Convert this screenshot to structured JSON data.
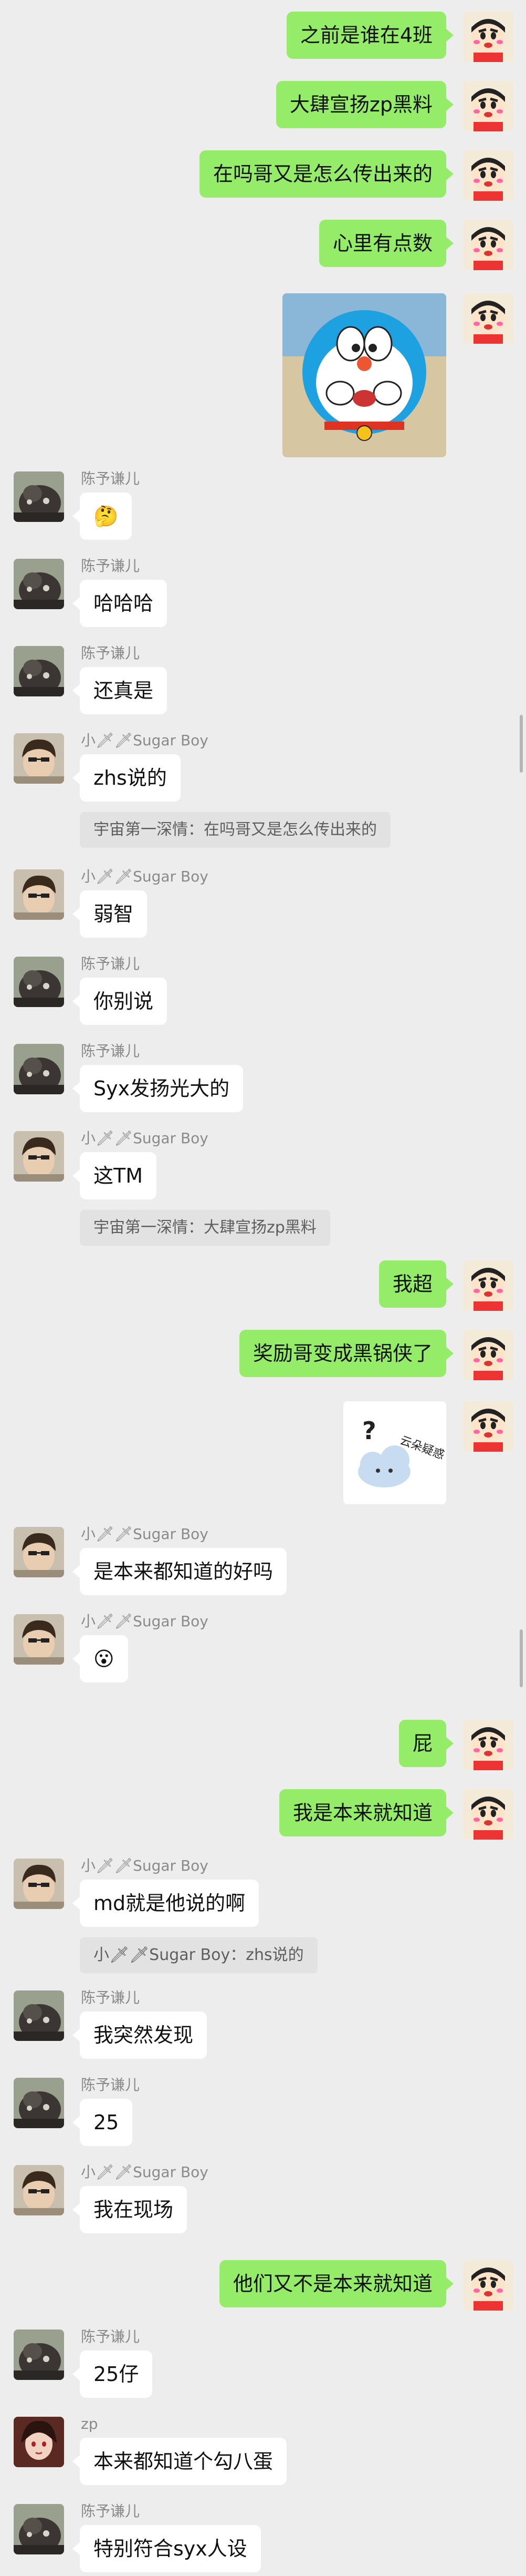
{
  "messages": [
    {
      "side": "self",
      "text": "之前是谁在4班"
    },
    {
      "side": "self",
      "text": "大肆宣扬zp黑料"
    },
    {
      "side": "self",
      "text": "在吗哥又是怎么传出来的"
    },
    {
      "side": "self",
      "text": "心里有点数"
    },
    {
      "side": "self",
      "image": "doraemon-sticker"
    },
    {
      "side": "other",
      "sender": "陈予谦儿",
      "emoji": "🤔"
    },
    {
      "side": "other",
      "sender": "陈予谦儿",
      "text": "哈哈哈"
    },
    {
      "side": "other",
      "sender": "陈予谦儿",
      "text": "还真是"
    },
    {
      "side": "other",
      "sender": "小🗡🗡Sugar Boy",
      "text": "zhs说的",
      "quote": "宇宙第一深情：在吗哥又是怎么传出来的"
    },
    {
      "side": "other",
      "sender": "小🗡🗡Sugar Boy",
      "text": "弱智"
    },
    {
      "side": "other",
      "sender": "陈予谦儿",
      "text": "你别说"
    },
    {
      "side": "other",
      "sender": "陈予谦儿",
      "text": "Syx发扬光大的"
    },
    {
      "side": "other",
      "sender": "小🗡🗡Sugar Boy",
      "text": "这TM",
      "quote": "宇宙第一深情：大肆宣扬zp黑料"
    },
    {
      "side": "self",
      "text": "我超"
    },
    {
      "side": "self",
      "text": "奖励哥变成黑锅侠了"
    },
    {
      "side": "self",
      "image": "cloud-sticker",
      "sticker_text": "云朵疑惑"
    },
    {
      "side": "other",
      "sender": "小🗡🗡Sugar Boy",
      "text": "是本来都知道的好吗"
    },
    {
      "side": "other",
      "sender": "小🗡🗡Sugar Boy",
      "emoji": "😮"
    },
    {
      "side": "self",
      "text": "屁"
    },
    {
      "side": "self",
      "text": "我是本来就知道"
    },
    {
      "side": "other",
      "sender": "小🗡🗡Sugar Boy",
      "text": "md就是他说的啊",
      "quote": "小🗡🗡Sugar Boy：zhs说的"
    },
    {
      "side": "other",
      "sender": "陈予谦儿",
      "text": "我突然发现"
    },
    {
      "side": "other",
      "sender": "陈予谦儿",
      "text": "25"
    },
    {
      "side": "other",
      "sender": "小🗡🗡Sugar Boy",
      "text": "我在现场"
    },
    {
      "side": "self",
      "text": "他们又不是本来就知道"
    },
    {
      "side": "other",
      "sender": "陈予谦儿",
      "text": "25仔"
    },
    {
      "side": "other",
      "sender": "zp",
      "text": "本来都知道个勾八蛋"
    },
    {
      "side": "other",
      "sender": "陈予谦儿",
      "text": "特别符合syx人设"
    }
  ],
  "colors": {
    "self_bubble": "#95ec69",
    "other_bubble": "#ffffff",
    "background": "#ededed",
    "quote_bg": "#e2e2e2"
  }
}
